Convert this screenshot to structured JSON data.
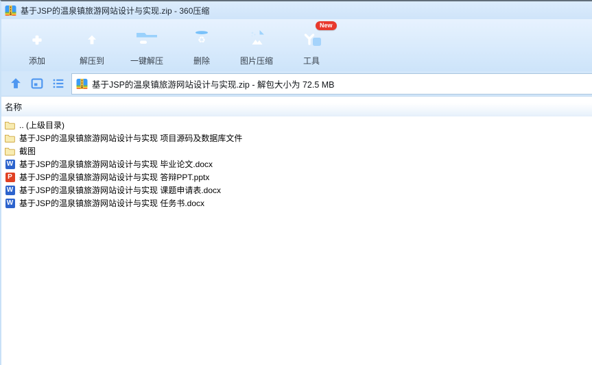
{
  "window": {
    "title": "基于JSP的温泉镇旅游网站设计与实现.zip - 360压缩",
    "app_icon": "zip-archive-icon"
  },
  "toolbar": {
    "items": [
      {
        "id": "add",
        "label": "添加",
        "icon": "add-folder-icon"
      },
      {
        "id": "extract-to",
        "label": "解压到",
        "icon": "extract-folder-icon"
      },
      {
        "id": "one-click-extract",
        "label": "一键解压",
        "icon": "oneclick-extract-icon"
      },
      {
        "id": "delete",
        "label": "删除",
        "icon": "delete-trash-icon"
      },
      {
        "id": "image-compress",
        "label": "图片压缩",
        "icon": "image-compress-icon"
      },
      {
        "id": "tools",
        "label": "工具",
        "icon": "tools-cube-icon",
        "badge": "New"
      }
    ]
  },
  "addressbar": {
    "icons": [
      "up-icon",
      "preview-pane-icon",
      "list-view-icon"
    ],
    "path": "基于JSP的温泉镇旅游网站设计与实现.zip - 解包大小为 72.5 MB"
  },
  "filelist": {
    "header": "名称",
    "file_badges": {
      "word": "W",
      "ppt": "P"
    },
    "items": [
      {
        "type": "parent-folder",
        "label": ".. (上级目录)"
      },
      {
        "type": "folder",
        "label": "基于JSP的温泉镇旅游网站设计与实现 项目源码及数据库文件"
      },
      {
        "type": "folder",
        "label": "截图"
      },
      {
        "type": "word",
        "label": "基于JSP的温泉镇旅游网站设计与实现 毕业论文.docx"
      },
      {
        "type": "ppt",
        "label": "基于JSP的温泉镇旅游网站设计与实现 答辩PPT.pptx"
      },
      {
        "type": "word",
        "label": "基于JSP的温泉镇旅游网站设计与实现 课题申请表.docx"
      },
      {
        "type": "word",
        "label": "基于JSP的温泉镇旅游网站设计与实现 任务书.docx"
      }
    ]
  },
  "colors": {
    "accent_blue": "#1f7ce8",
    "badge_red": "#e8392d",
    "folder_yellow": "#f8ecb2",
    "word_blue": "#2c63cd",
    "ppt_red": "#e04023",
    "titlebar_blue": "#d5e8fb"
  }
}
